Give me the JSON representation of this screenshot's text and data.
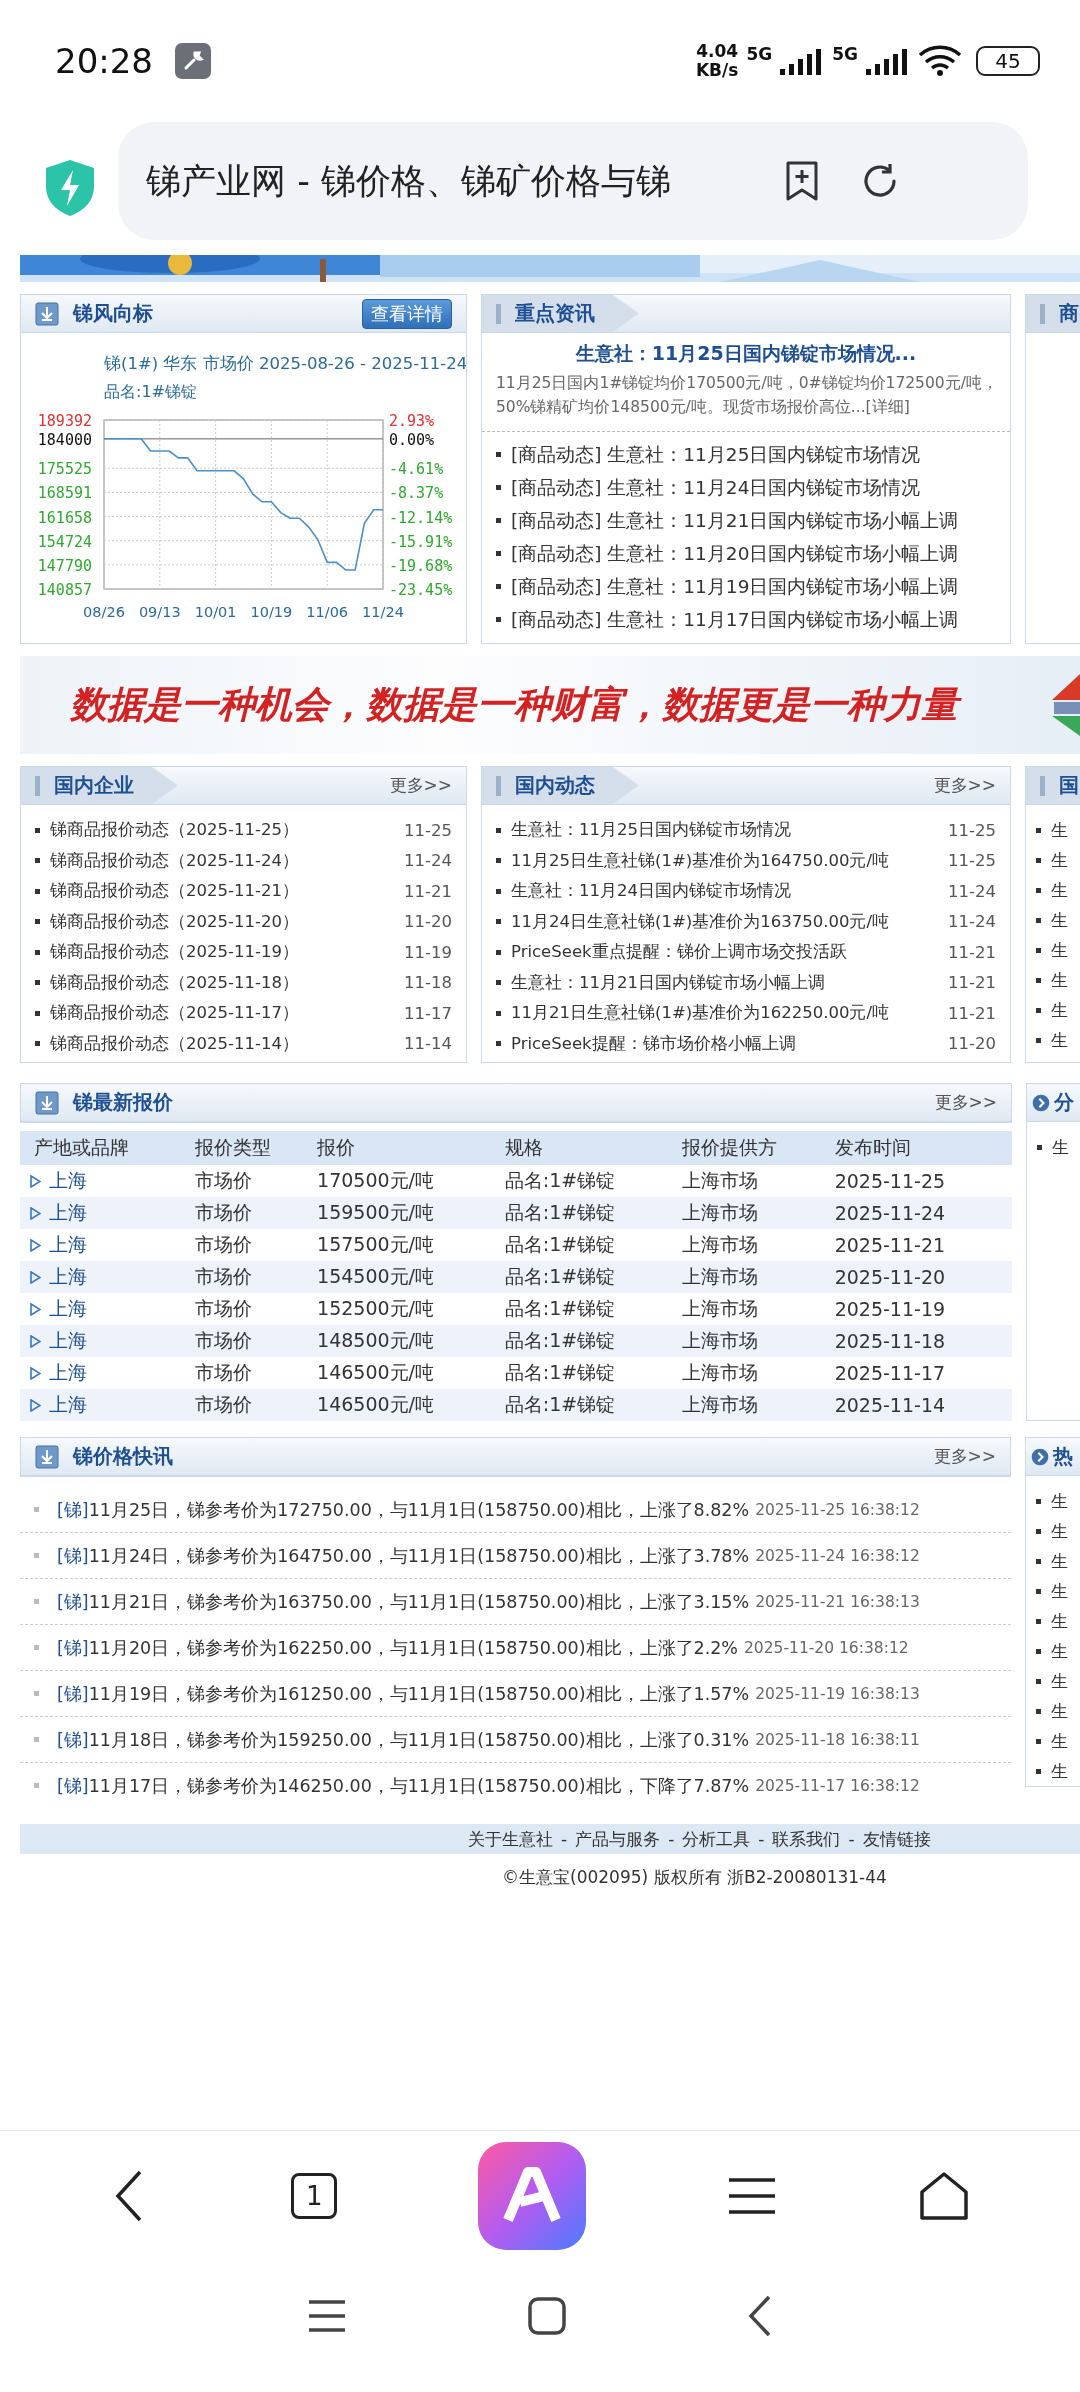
{
  "status_bar": {
    "time": "20:28",
    "speed_value": "4.04",
    "speed_unit": "KB/s",
    "network_1": "5G",
    "network_2": "5G",
    "battery": "45"
  },
  "browser": {
    "title": "锑产业网 - 锑价格、锑矿价格与锑"
  },
  "trend_panel": {
    "header": {
      "kind": "icon",
      "title": "锑风向标",
      "action": "查看详情"
    },
    "chart_subtitle": "品名:1#锑锭",
    "right_labels": [
      "2.93%",
      "0.00%",
      "-4.61%",
      "-8.37%",
      "-12.14%",
      "-15.91%",
      "-19.68%",
      "-23.45%"
    ],
    "chart_data": {
      "type": "line",
      "title": "锑(1#) 华东 市场价 2025-08-26 - 2025-11-24",
      "categories": [
        "08/26",
        null,
        null,
        null,
        null,
        null,
        "09/13",
        null,
        null,
        null,
        null,
        null,
        "10/01",
        null,
        null,
        null,
        null,
        null,
        "10/19",
        null,
        null,
        null,
        null,
        null,
        "11/06",
        null,
        null,
        null,
        null,
        null,
        "11/24"
      ],
      "series": [
        {
          "color": "#4a8fc8",
          "values": [
            184000,
            184000,
            184000,
            184000,
            184000,
            180500,
            180500,
            180500,
            178500,
            178500,
            174800,
            174800,
            174800,
            174800,
            174800,
            172500,
            168100,
            165900,
            165900,
            162800,
            161200,
            161200,
            158700,
            155000,
            148500,
            148500,
            146300,
            146300,
            159700,
            163600,
            163600
          ]
        }
      ],
      "ylim": [
        140857,
        189392
      ],
      "grid": true,
      "yticks": [
        189392,
        184000,
        175525,
        168591,
        161658,
        154724,
        147790,
        140857
      ],
      "ref_lines": [
        {
          "axis": "y",
          "value": 184000
        }
      ]
    }
  },
  "key_news_panel": {
    "header": {
      "kind": "tab",
      "title": "重点资讯"
    },
    "featured": {
      "title": "生意社：11月25日国内锑锭市场情况...",
      "summary": "11月25日国内1#锑锭均价170500元/吨，0#锑锭均价172500元/吨，50%锑精矿均价148500元/吨。现货市场报价高位...[详细]"
    },
    "items": [
      "[商品动态] 生意社：11月25日国内锑锭市场情况",
      "[商品动态] 生意社：11月24日国内锑锭市场情况",
      "[商品动态] 生意社：11月21日国内锑锭市场小幅上调",
      "[商品动态] 生意社：11月20日国内锑锭市场小幅上调",
      "[商品动态] 生意社：11月19日国内锑锭市场小幅上调",
      "[商品动态] 生意社：11月17日国内锑锭市场小幅上调"
    ]
  },
  "side_panel_top": {
    "header": {
      "kind": "tab",
      "title": "商"
    }
  },
  "slogan_banner": {
    "text": "数据是一种机会，数据是一种财富，数据更是一种力量"
  },
  "domestic_companies": {
    "header": {
      "kind": "tab",
      "title": "国内企业",
      "more": "更多>>"
    },
    "items": [
      {
        "text": "锑商品报价动态（2025-11-25）",
        "date": "11-25"
      },
      {
        "text": "锑商品报价动态（2025-11-24）",
        "date": "11-24"
      },
      {
        "text": "锑商品报价动态（2025-11-21）",
        "date": "11-21"
      },
      {
        "text": "锑商品报价动态（2025-11-20）",
        "date": "11-20"
      },
      {
        "text": "锑商品报价动态（2025-11-19）",
        "date": "11-19"
      },
      {
        "text": "锑商品报价动态（2025-11-18）",
        "date": "11-18"
      },
      {
        "text": "锑商品报价动态（2025-11-17）",
        "date": "11-17"
      },
      {
        "text": "锑商品报价动态（2025-11-14）",
        "date": "11-14"
      }
    ]
  },
  "domestic_news": {
    "header": {
      "kind": "tab",
      "title": "国内动态",
      "more": "更多>>"
    },
    "items": [
      {
        "text": "生意社：11月25日国内锑锭市场情况",
        "date": "11-25"
      },
      {
        "text": "11月25日生意社锑(1#)基准价为164750.00元/吨",
        "date": "11-25"
      },
      {
        "text": "生意社：11月24日国内锑锭市场情况",
        "date": "11-24"
      },
      {
        "text": "11月24日生意社锑(1#)基准价为163750.00元/吨",
        "date": "11-24"
      },
      {
        "text": "PriceSeek重点提醒：锑价上调市场交投活跃",
        "date": "11-21"
      },
      {
        "text": "生意社：11月21日国内锑锭市场小幅上调",
        "date": "11-21"
      },
      {
        "text": "11月21日生意社锑(1#)基准价为162250.00元/吨",
        "date": "11-21"
      },
      {
        "text": "PriceSeek提醒：锑市场价格小幅上调",
        "date": "11-20"
      }
    ]
  },
  "side_panel_mid": {
    "header": {
      "kind": "tab",
      "title": "国"
    },
    "items": [
      "生",
      "生",
      "生",
      "生",
      "生",
      "生",
      "生",
      "生"
    ]
  },
  "quotes": {
    "header": {
      "kind": "icon",
      "title": "锑最新报价",
      "more": "更多>>"
    },
    "table": {
      "columns": [
        "产地或品牌",
        "报价类型",
        "报价",
        "规格",
        "报价提供方",
        "发布时间"
      ],
      "rows": [
        [
          "上海",
          "市场价",
          "170500元/吨",
          "品名:1#锑锭",
          "上海市场",
          "2025-11-25"
        ],
        [
          "上海",
          "市场价",
          "159500元/吨",
          "品名:1#锑锭",
          "上海市场",
          "2025-11-24"
        ],
        [
          "上海",
          "市场价",
          "157500元/吨",
          "品名:1#锑锭",
          "上海市场",
          "2025-11-21"
        ],
        [
          "上海",
          "市场价",
          "154500元/吨",
          "品名:1#锑锭",
          "上海市场",
          "2025-11-20"
        ],
        [
          "上海",
          "市场价",
          "152500元/吨",
          "品名:1#锑锭",
          "上海市场",
          "2025-11-19"
        ],
        [
          "上海",
          "市场价",
          "148500元/吨",
          "品名:1#锑锭",
          "上海市场",
          "2025-11-18"
        ],
        [
          "上海",
          "市场价",
          "146500元/吨",
          "品名:1#锑锭",
          "上海市场",
          "2025-11-17"
        ],
        [
          "上海",
          "市场价",
          "146500元/吨",
          "品名:1#锑锭",
          "上海市场",
          "2025-11-14"
        ]
      ]
    }
  },
  "side_panel_quotes": {
    "header": {
      "kind": "round",
      "title": "分"
    },
    "items": [
      "生"
    ]
  },
  "flash": {
    "header": {
      "kind": "icon",
      "title": "锑价格快讯",
      "more": "更多>>"
    },
    "items": [
      {
        "tag": "[锑]",
        "text": "11月25日，锑参考价为172750.00，与11月1日(158750.00)相比，上涨了8.82%",
        "time": "2025-11-25 16:38:12"
      },
      {
        "tag": "[锑]",
        "text": "11月24日，锑参考价为164750.00，与11月1日(158750.00)相比，上涨了3.78%",
        "time": "2025-11-24 16:38:12"
      },
      {
        "tag": "[锑]",
        "text": "11月21日，锑参考价为163750.00，与11月1日(158750.00)相比，上涨了3.15%",
        "time": "2025-11-21 16:38:13"
      },
      {
        "tag": "[锑]",
        "text": "11月20日，锑参考价为162250.00，与11月1日(158750.00)相比，上涨了2.2%",
        "time": "2025-11-20 16:38:12"
      },
      {
        "tag": "[锑]",
        "text": "11月19日，锑参考价为161250.00，与11月1日(158750.00)相比，上涨了1.57%",
        "time": "2025-11-19 16:38:13"
      },
      {
        "tag": "[锑]",
        "text": "11月18日，锑参考价为159250.00，与11月1日(158750.00)相比，上涨了0.31%",
        "time": "2025-11-18 16:38:11"
      },
      {
        "tag": "[锑]",
        "text": "11月17日，锑参考价为146250.00，与11月1日(158750.00)相比，下降了7.87%",
        "time": "2025-11-17 16:38:12"
      }
    ]
  },
  "side_panel_flash": {
    "header": {
      "kind": "round",
      "title": "热"
    },
    "items": [
      "生",
      "生",
      "生",
      "生",
      "生",
      "生",
      "生",
      "生",
      "生",
      "生"
    ]
  },
  "footer": {
    "links": [
      "关于生意社",
      "产品与服务",
      "分析工具",
      "联系我们",
      "友情链接"
    ],
    "separator": "-",
    "copyright": "©生意宝(002095) 版权所有 浙B2-20080131-44"
  },
  "bottom_nav": {
    "tab_count": "1"
  }
}
